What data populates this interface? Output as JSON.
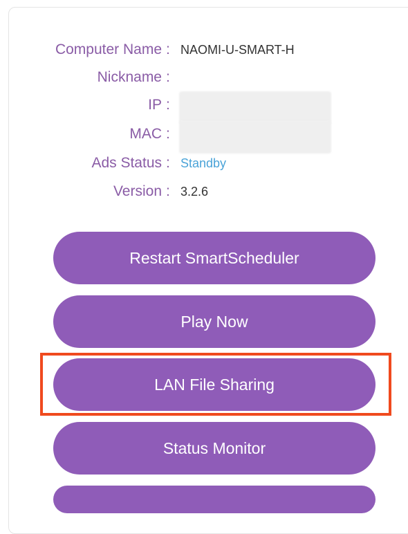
{
  "info": {
    "computer_name_label": "Computer Name",
    "computer_name_value": "NAOMI-U-SMART-H",
    "nickname_label": "Nickname",
    "nickname_value": "",
    "ip_label": "IP",
    "mac_label": "MAC",
    "ads_status_label": "Ads Status",
    "ads_status_value": "Standby",
    "version_label": "Version",
    "version_value": "3.2.6",
    "colon": ":"
  },
  "buttons": {
    "restart_label": "Restart SmartScheduler",
    "play_now_label": "Play Now",
    "lan_file_sharing_label": "LAN File Sharing",
    "status_monitor_label": "Status Monitor"
  },
  "colors": {
    "label": "#8a5ca6",
    "button": "#8f5cb8",
    "link": "#4aa3d8",
    "highlight": "#f04a1e"
  }
}
